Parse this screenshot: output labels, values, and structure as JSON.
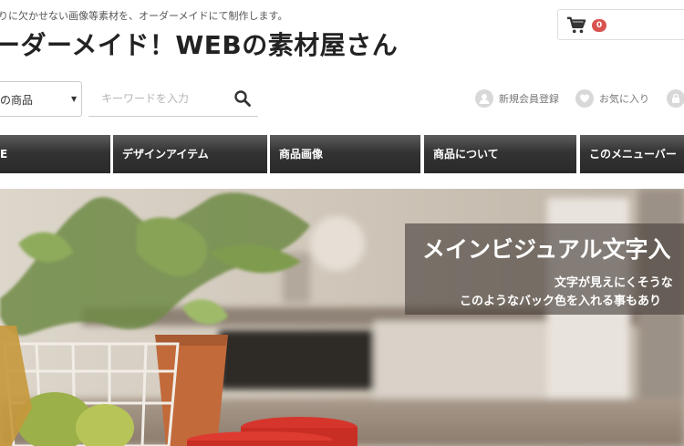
{
  "header": {
    "tagline": "りに欠かせない画像等素材を、オーダーメイドにて制作します。",
    "site_title": "ーダーメイド！WEBの素材屋さん"
  },
  "cart": {
    "count": "0"
  },
  "search": {
    "category_label": "の商品",
    "placeholder": "キーワードを入力"
  },
  "utility_links": {
    "register": "新規会員登録",
    "favorites": "お気に入り"
  },
  "global_nav": {
    "items": [
      {
        "label": "E"
      },
      {
        "label": "デザインアイテム"
      },
      {
        "label": "商品画像"
      },
      {
        "label": "商品について"
      },
      {
        "label": "このメニューバー"
      }
    ]
  },
  "hero": {
    "title": "メインビジュアル文字入",
    "subtitle_line1": "文字が見えにくそうな",
    "subtitle_line2": "このようなバック色を入れる事もあり"
  },
  "colors": {
    "badge": "#d9534f",
    "nav_bg": "#333333",
    "accent_text": "#222222"
  }
}
